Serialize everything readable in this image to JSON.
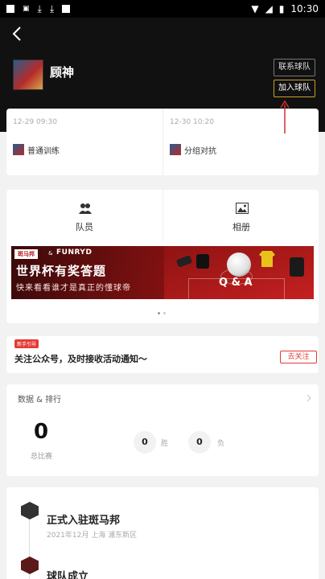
{
  "status_bar": {
    "time": "10:30"
  },
  "header": {
    "team_name": "顾神",
    "contact_button": "联系球队",
    "join_button": "加入球队"
  },
  "schedule": [
    {
      "time": "12-29 09:30",
      "label": "普通训练"
    },
    {
      "time": "12-30 10:20",
      "label": "分组对抗"
    }
  ],
  "tabs": [
    {
      "label": "队员",
      "icon": "members-icon"
    },
    {
      "label": "相册",
      "icon": "album-icon"
    }
  ],
  "banner": {
    "logo": "斑马邦",
    "amp": "&",
    "brand": "FUNRYD",
    "title": "世界杯有奖答题",
    "subtitle": "快来看看谁才是真正的懂球帝",
    "qa": "Q & A"
  },
  "follow": {
    "tag": "新手引导",
    "text": "关注公众号，及时接收活动通知～",
    "button": "去关注"
  },
  "stats": {
    "title": "数据 & 排行",
    "total": "0",
    "total_label": "总比赛",
    "wins": "0",
    "wins_label": "胜",
    "losses": "0",
    "losses_label": "负"
  },
  "timeline": [
    {
      "title": "正式入驻斑马邦",
      "sub": "2021年12月  上海 浦东新区"
    },
    {
      "title": "球队成立",
      "sub": ""
    }
  ],
  "colors": {
    "header_bg": "#111111",
    "accent_gold": "#c8a227",
    "accent_red": "#e53935"
  }
}
